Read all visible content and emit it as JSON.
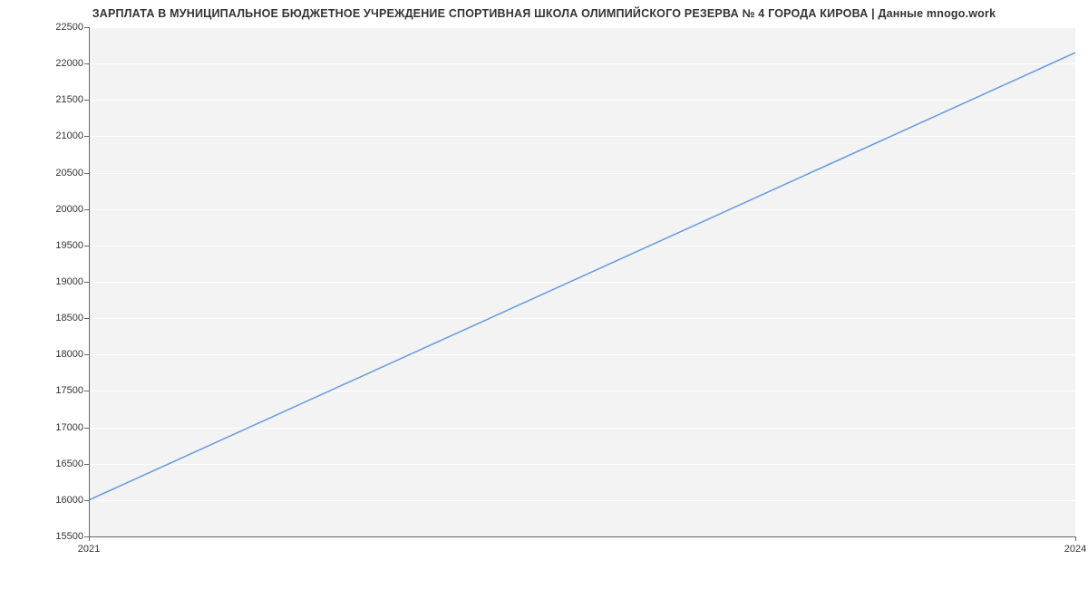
{
  "chart_data": {
    "type": "line",
    "title": "ЗАРПЛАТА В МУНИЦИПАЛЬНОЕ БЮДЖЕТНОЕ УЧРЕЖДЕНИЕ СПОРТИВНАЯ ШКОЛА ОЛИМПИЙСКОГО РЕЗЕРВА № 4 ГОРОДА КИРОВА | Данные mnogo.work",
    "x": [
      2021,
      2024
    ],
    "values": [
      16000,
      22150
    ],
    "xlabel": "",
    "ylabel": "",
    "xlim": [
      2021,
      2024
    ],
    "ylim": [
      15500,
      22500
    ],
    "x_ticks": [
      2021,
      2024
    ],
    "y_ticks": [
      15500,
      16000,
      16500,
      17000,
      17500,
      18000,
      18500,
      19000,
      19500,
      20000,
      20500,
      21000,
      21500,
      22000,
      22500
    ],
    "line_color": "#6699e0",
    "grid_color": "#ffffff",
    "bg_color": "#f3f3f3"
  }
}
